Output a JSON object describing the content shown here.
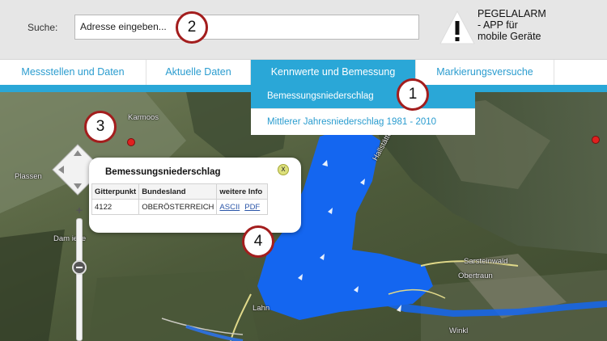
{
  "header": {
    "search_label": "Suche:",
    "search_value": "Adresse eingeben...",
    "alarm_text": "PEGELALARM\n- APP für\nmobile Geräte"
  },
  "nav": {
    "items": [
      {
        "label": "Messstellen und Daten",
        "active": false
      },
      {
        "label": "Aktuelle Daten",
        "active": false
      },
      {
        "label": "Kennwerte und Bemessung",
        "active": true
      },
      {
        "label": "Markierungsversuche",
        "active": false
      }
    ]
  },
  "dropdown": {
    "items": [
      {
        "label": "Bemessungsniederschlag",
        "selected": true
      },
      {
        "label": "Mittlerer Jahresniederschlag 1981 - 2010",
        "selected": false
      }
    ]
  },
  "popup": {
    "title": "Bemessungsniederschlag",
    "close_label": "x",
    "columns": [
      "Gitterpunkt",
      "Bundesland",
      "weitere Info"
    ],
    "row": {
      "gitterpunkt": "4122",
      "bundesland": "OBERÖSTERREICH",
      "link_ascii": "ASCII",
      "link_pdf": "PDF"
    }
  },
  "map": {
    "labels": {
      "karmoos": "Karmoos",
      "plassen": "Plassen",
      "hallstaetter": "Hallstätter",
      "sarsteinwald": "Sarsteinwald",
      "obertraun": "Obertraun",
      "lahn": "Lahn",
      "winkl": "Winkl",
      "damwiese": "Dam    iese"
    },
    "zoom_plus": "+"
  },
  "annotations": [
    "1",
    "2",
    "3",
    "4"
  ],
  "colors": {
    "accent": "#2aa7d7",
    "link": "#2a9ccf",
    "lake": "#1466f0",
    "marker_ring": "#a31d1d",
    "pin": "#e0201f"
  }
}
